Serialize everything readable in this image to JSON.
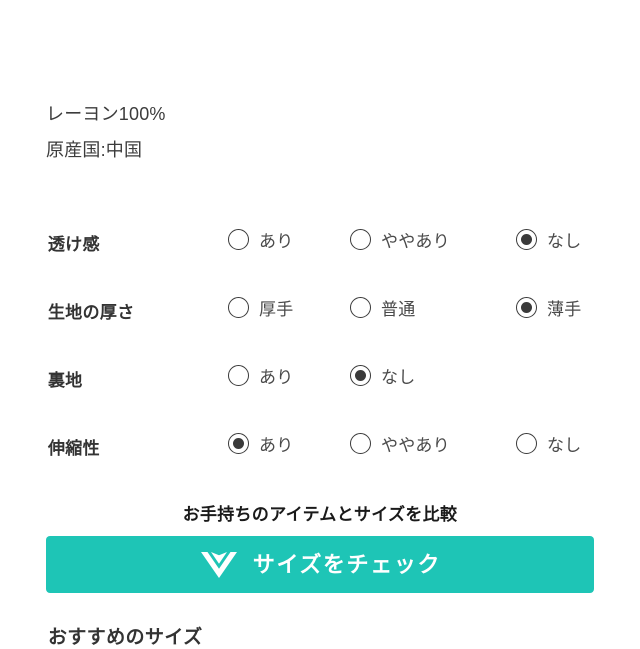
{
  "material": {
    "composition": "レーヨン100%",
    "origin": "原産国:中国"
  },
  "specs": {
    "rows": [
      {
        "label": "透け感",
        "options": [
          {
            "label": "あり",
            "selected": false
          },
          {
            "label": "ややあり",
            "selected": false
          },
          {
            "label": "なし",
            "selected": true
          }
        ]
      },
      {
        "label": "生地の厚さ",
        "options": [
          {
            "label": "厚手",
            "selected": false
          },
          {
            "label": "普通",
            "selected": false
          },
          {
            "label": "薄手",
            "selected": true
          }
        ]
      },
      {
        "label": "裏地",
        "options": [
          {
            "label": "あり",
            "selected": false
          },
          {
            "label": "なし",
            "selected": true
          }
        ]
      },
      {
        "label": "伸縮性",
        "options": [
          {
            "label": "あり",
            "selected": true
          },
          {
            "label": "ややあり",
            "selected": false
          },
          {
            "label": "なし",
            "selected": false
          }
        ]
      }
    ]
  },
  "compare": {
    "heading": "お手持ちのアイテムとサイズを比較",
    "button_label": "サイズをチェック",
    "button_icon": "v-chevron-logo-icon",
    "button_color": "#1ec5b6",
    "button_text_color": "#ffffff"
  },
  "recommended": {
    "heading": "おすすめのサイズ"
  }
}
